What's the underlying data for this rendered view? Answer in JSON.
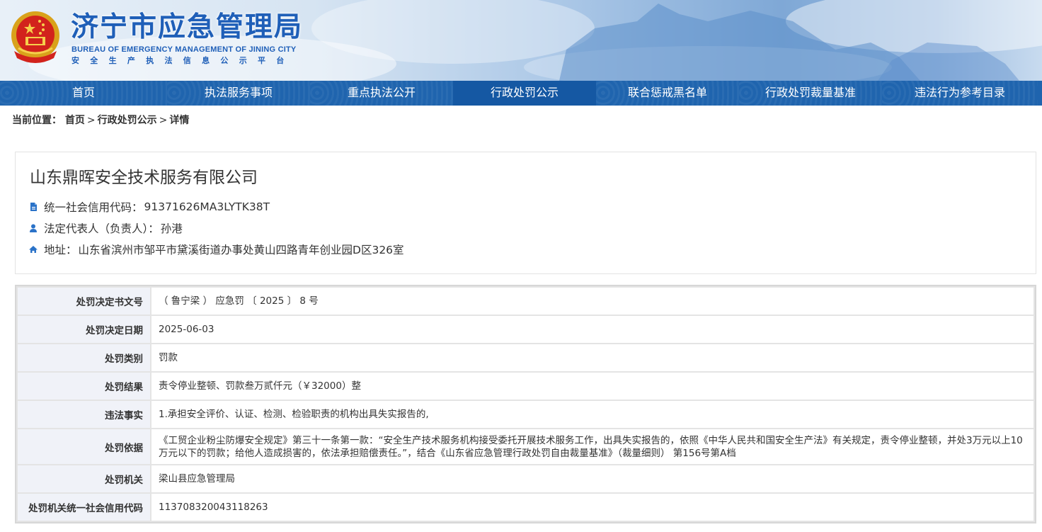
{
  "header": {
    "title": "济宁市应急管理局",
    "subtitle_en": "BUREAU OF EMERGENCY MANAGEMENT OF JINING CITY",
    "subtitle_cn": "安全生产执法信息公示平台",
    "emblem_icon": "national-emblem-icon"
  },
  "nav": {
    "items": [
      {
        "label": "首页"
      },
      {
        "label": "执法服务事项"
      },
      {
        "label": "重点执法公开"
      },
      {
        "label": "行政处罚公示"
      },
      {
        "label": "联合惩戒黑名单"
      },
      {
        "label": "行政处罚裁量基准"
      },
      {
        "label": "违法行为参考目录"
      }
    ],
    "active_index": 3
  },
  "breadcrumb": {
    "prefix": "当前位置：",
    "items": [
      "首页",
      "行政处罚公示",
      "详情"
    ],
    "separator": ">"
  },
  "company": {
    "name": "山东鼎晖安全技术服务有限公司",
    "credit_label": "统一社会信用代码：",
    "credit_code": "91371626MA3LYTK38T",
    "legal_label": "法定代表人（负责人）：",
    "legal_person": "孙港",
    "address_label": "地址：",
    "address": "山东省滨州市邹平市黛溪街道办事处黄山四路青年创业园D区326室"
  },
  "details": {
    "rows": [
      {
        "label": "处罚决定书文号",
        "value": "（ 鲁宁梁 ） 应急罚 〔 2025 〕 8 号"
      },
      {
        "label": "处罚决定日期",
        "value": "2025-06-03"
      },
      {
        "label": "处罚类别",
        "value": "罚款"
      },
      {
        "label": "处罚结果",
        "value": "责令停业整顿、罚款叁万贰仟元（￥32000）整"
      },
      {
        "label": "违法事实",
        "value": "1.承担安全评价、认证、检测、检验职责的机构出具失实报告的,"
      },
      {
        "label": "处罚依据",
        "value": "《工贸企业粉尘防爆安全规定》第三十一条第一款：“安全生产技术服务机构接受委托开展技术服务工作，出具失实报告的，依照《中华人民共和国安全生产法》有关规定，责令停业整顿，并处3万元以上10万元以下的罚款；给他人造成损害的，依法承担赔偿责任。”，结合《山东省应急管理行政处罚自由裁量基准》（裁量细则） 第156号第A档"
      },
      {
        "label": "处罚机关",
        "value": "梁山县应急管理局"
      },
      {
        "label": "处罚机关统一社会信用代码",
        "value": "113708320043118263"
      }
    ]
  },
  "colors": {
    "nav_bg": "#1f64ae",
    "nav_active": "#1558a3",
    "title_blue": "#1f5fb8",
    "icon_blue": "#2a72c8",
    "label_cell_bg": "#f0f2f8"
  }
}
